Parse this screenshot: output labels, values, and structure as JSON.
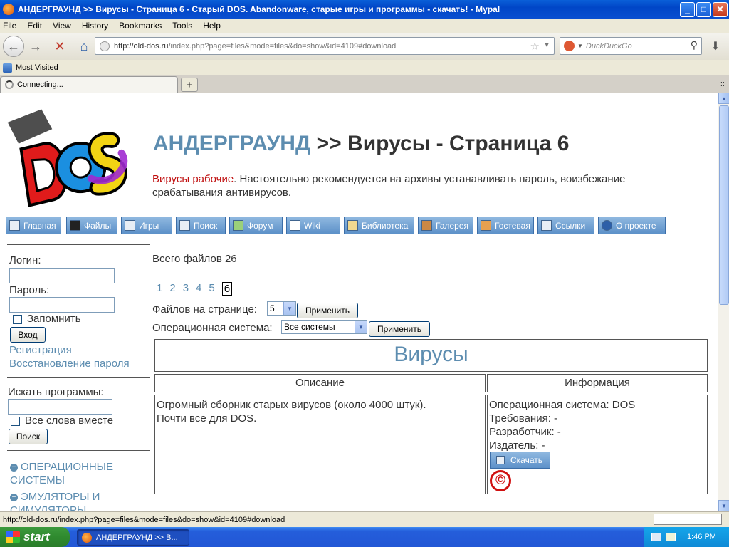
{
  "window": {
    "title": "АНДЕРГРАУНД >> Вирусы - Страница 6 - Старый DOS. Abandonware, старые игры и программы - скачать! - Mypal",
    "minimize": "_",
    "maximize": "□",
    "close": "✕"
  },
  "menu": [
    "File",
    "Edit",
    "View",
    "History",
    "Bookmarks",
    "Tools",
    "Help"
  ],
  "nav": {
    "url_host": "http://old-dos.ru",
    "url_rest": "/index.php?page=files&mode=files&do=show&id=4109#download",
    "search_placeholder": "DuckDuckGo"
  },
  "bookmarks": {
    "most_visited": "Most Visited"
  },
  "tab": {
    "label": "Connecting...",
    "new_tab": "+",
    "tab_menu": "::"
  },
  "page": {
    "headline_link": "АНДЕРГРАУНД",
    "headline_rest": " >> Вирусы - Страница 6",
    "sub_red": "Вирусы рабочие",
    "sub_rest": ". Настоятельно рекомендуется на архивы устанавливать пароль, воизбежание срабатывания антивирусов.",
    "menu_buttons": [
      "Главная",
      "Файлы",
      "Игры",
      "Поиск",
      "Форум",
      "Wiki",
      "Библиотека",
      "Галерея",
      "Гостевая",
      "Ссылки",
      "О проекте"
    ],
    "login": {
      "login_label": "Логин:",
      "password_label": "Пароль:",
      "remember": "Запомнить",
      "enter_button": "Вход",
      "register": "Регистрация",
      "restore": "Восстановление пароля"
    },
    "search": {
      "label": "Искать программы:",
      "all_words": "Все слова вместе",
      "button": "Поиск"
    },
    "categories": [
      "ОПЕРАЦИОННЫЕ СИСТЕМЫ",
      "ЭМУЛЯТОРЫ И СИМУЛЯТОРЫ"
    ],
    "total_files": "Всего файлов 26",
    "pages": [
      "1",
      "2",
      "3",
      "4",
      "5",
      "6"
    ],
    "current_page": "6",
    "per_page_label": "Файлов на странице:",
    "per_page_value": "5",
    "apply_button": "Применить",
    "os_label": "Операционная система:",
    "os_value": "Все системы",
    "section_title": "Вирусы",
    "col_description": "Описание",
    "col_info": "Информация",
    "description_line1": "Огромный сборник старых вирусов (около 4000 штук).",
    "description_line2": "Почти все для DOS.",
    "info_os": "Операционная система: DOS",
    "info_req": "Требования: -",
    "info_dev": "Разработчик: -",
    "info_pub": "Издатель: -",
    "download_button": "Скачать",
    "copyright_mark": "©"
  },
  "status": {
    "text": "http://old-dos.ru/index.php?page=files&mode=files&do=show&id=4109#download"
  },
  "taskbar": {
    "start": "start",
    "task_item": "АНДЕРГРАУНД >> В...",
    "clock": "1:46 PM"
  }
}
